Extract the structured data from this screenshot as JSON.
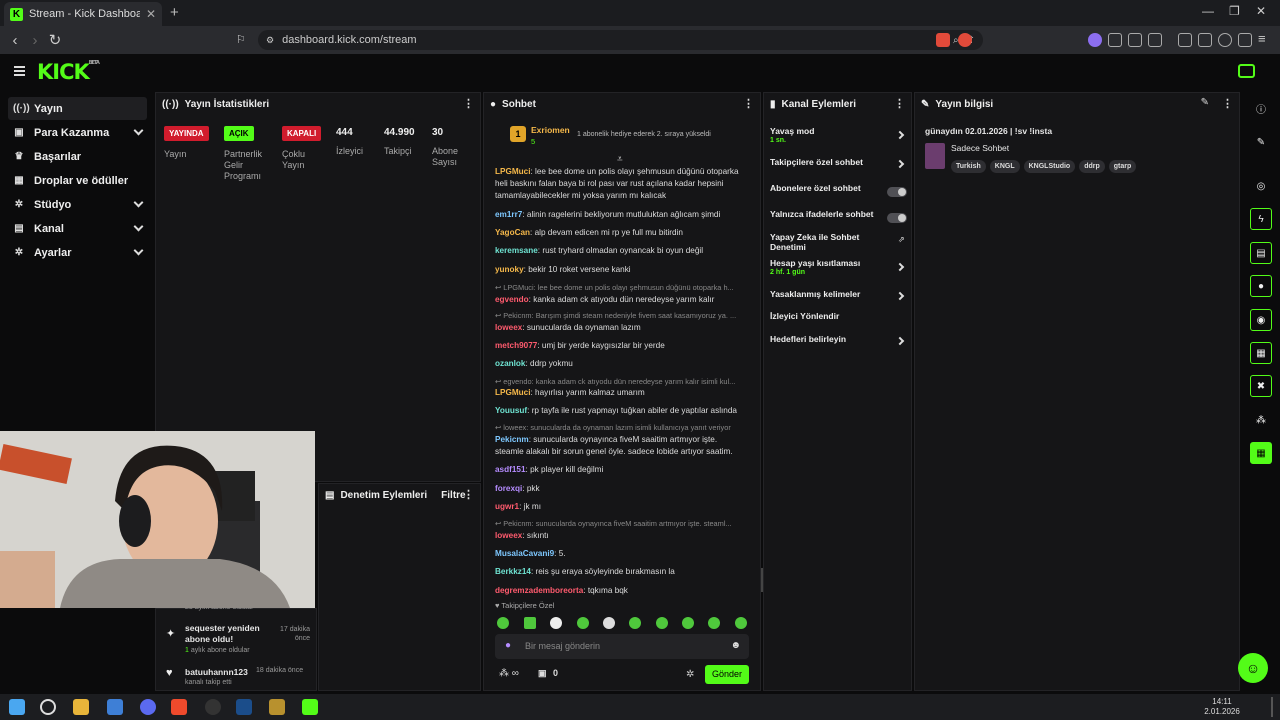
{
  "browser": {
    "tab_title": "Stream - Kick Dashboard",
    "url": "dashboard.kick.com/stream"
  },
  "brand": {
    "logo": "KICK",
    "logo_sup": "BETA",
    "accent": "#53fc18"
  },
  "sidebar": {
    "items": [
      {
        "label": "Yayın",
        "icon": "broadcast-icon"
      },
      {
        "label": "Para Kazanma",
        "icon": "money-icon"
      },
      {
        "label": "Başarılar",
        "icon": "trophy-icon"
      },
      {
        "label": "Droplar ve ödüller",
        "icon": "gift-icon"
      },
      {
        "label": "Stüdyo",
        "icon": "gear-icon"
      },
      {
        "label": "Kanal",
        "icon": "tv-icon"
      },
      {
        "label": "Ayarlar",
        "icon": "gear-icon"
      }
    ]
  },
  "stats": {
    "title": "Yayın İstatistikleri",
    "items": [
      {
        "badge": "YAYINDA",
        "label": "Yayın"
      },
      {
        "badge": "AÇIK",
        "label": "Partnerlik Gelir Programı"
      },
      {
        "badge": "KAPALI",
        "label": "Çoklu Yayın"
      },
      {
        "value": "444",
        "label": "İzleyici"
      },
      {
        "value": "44.990",
        "label": "Takipçi"
      },
      {
        "value": "30",
        "label": "Abone Sayısı"
      }
    ]
  },
  "moderation": {
    "title": "Denetim Eylemleri",
    "filter": "Filtre"
  },
  "activity": [
    {
      "name": "sequester yeniden abone oldu!",
      "time": "17 dakika önce",
      "detail_num": "1",
      "detail": "aylık abone oldular"
    },
    {
      "name": "batuuhannn123",
      "time": "18 dakika önce",
      "detail_num": "",
      "detail": "kanalı takip etti"
    }
  ],
  "activity_partial": "23 aylık abone oldular",
  "chat": {
    "title": "Sohbet",
    "pinned_user": "Exriomen",
    "pinned_count": "5",
    "pinned_text": "1 abonelik hediye ederek 2. sıraya yükseldi",
    "pinned_rank": "1",
    "lines": [
      {
        "u": "LPGMuci",
        "c": "#f5b84a",
        "t": "lee bee dome un polis olayı şehmusun düğünü otoparka"
      },
      {
        "u": "",
        "c": "",
        "t": "heli baskını falan baya bi rol pası var rust açılana kadar hepsini"
      },
      {
        "u": "",
        "c": "",
        "t": "tamamlayabilecekler mi yoksa yarım mı kalıcak"
      },
      {
        "u": "em1rr7",
        "c": "#7ec8ff",
        "t": "alinin ragelerini bekliyorum mutluluktan ağlıcam şimdi"
      },
      {
        "u": "YagoCan",
        "c": "#f5b84a",
        "t": "alp devam edicen mi rp ye full mu bitirdin"
      },
      {
        "u": "keremsane",
        "c": "#6fe3d2",
        "t": "rust tryhard olmadan oynancak bi oyun değil"
      },
      {
        "u": "yunoky",
        "c": "#f5b84a",
        "t": "bekir 10 roket versene kanki"
      },
      {
        "reply": "↩ LPGMuci: lee bee dome un polis olayı şehmusun düğünü otoparka h..."
      },
      {
        "u": "egvendo",
        "c": "#ff5b6e",
        "t": "kanka adam ck atıyodu dün neredeyse yarım kalır"
      },
      {
        "reply": "↩ Pekicnm: Barışım şimdi steam nedeniyle fivem saat kasamıyoruz ya. ..."
      },
      {
        "u": "loweex",
        "c": "#ff5b6e",
        "t": "sunucularda da oynaman lazım"
      },
      {
        "u": "metch9077",
        "c": "#ff5b6e",
        "t": "umj bir yerde kaygısızlar bir yerde"
      },
      {
        "u": "ozanlok",
        "c": "#6fe3d2",
        "t": "ddrp yokmu"
      },
      {
        "reply": "↩ egvendo: kanka adam ck atıyodu dün neredeyse yarım kalır isimli kul..."
      },
      {
        "u": "LPGMuci",
        "c": "#f5b84a",
        "t": "hayırlısı yarım kalmaz umarım"
      },
      {
        "u": "Youusuf",
        "c": "#6fe3d2",
        "t": "rp tayfa ile rust yapmayı tuğkan abiler de yaptılar aslında"
      },
      {
        "reply": "↩ loweex: sunucularda da oynaman lazım isimli kullanıcıya yanıt veriyor"
      },
      {
        "u": "Pekicnm",
        "c": "#7ec8ff",
        "t": "sunucularda oynayınca fiveM saaitim artmıyor işte."
      },
      {
        "u": "",
        "c": "",
        "t": "steamle alakalı bir sorun genel öyle. sadece lobide artıyor saatim."
      },
      {
        "u": "asdf151",
        "c": "#b58cff",
        "t": "pk player kill değilmi"
      },
      {
        "u": "forexqi",
        "c": "#b58cff",
        "t": "pkk"
      },
      {
        "u": "ugwr1",
        "c": "#ff5b6e",
        "t": "jk mı"
      },
      {
        "reply": "↩ Pekicnm: sunucularda oynayınca fiveM saaitim artmıyor işte. steaml..."
      },
      {
        "u": "loweex",
        "c": "#ff5b6e",
        "t": "sıkıntı"
      },
      {
        "u": "MusalaCavani9",
        "c": "#7ec8ff",
        "t": "5."
      },
      {
        "u": "Berkkz14",
        "c": "#6fe3d2",
        "t": "reis şu eraya söyleyinde bırakmasın la"
      },
      {
        "u": "degremzademboreorta",
        "c": "#ff5b6e",
        "t": "tqkıma bqk"
      }
    ],
    "follower_only": "Takipçilere Özel",
    "input_placeholder": "Bir mesaj gönderin",
    "send": "Gönder",
    "infinity": "∞",
    "points": "0"
  },
  "channel_actions": {
    "title": "Kanal Eylemleri",
    "items": [
      {
        "label": "Yavaş mod",
        "sub": "1 sn.",
        "ctl": "chev"
      },
      {
        "label": "Takipçilere özel sohbet",
        "sub": "",
        "ctl": "chev"
      },
      {
        "label": "Abonelere özel sohbet",
        "sub": "",
        "ctl": "toggle"
      },
      {
        "label": "Yalnızca ifadelerle sohbet",
        "sub": "",
        "ctl": "toggle"
      },
      {
        "label": "Yapay Zeka ile Sohbet Denetimi",
        "sub": "",
        "ctl": "ext"
      },
      {
        "label": "Hesap yaşı kısıtlaması",
        "sub": "2 hf. 1 gün",
        "ctl": "chev"
      },
      {
        "label": "Yasaklanmış kelimeler",
        "sub": "",
        "ctl": "chev"
      },
      {
        "label": "İzleyici Yönlendir",
        "sub": "",
        "ctl": ""
      },
      {
        "label": "Hedefleri belirleyin",
        "sub": "",
        "ctl": "chev"
      }
    ]
  },
  "stream_info": {
    "title": "Yayın bilgisi",
    "stream_title": "günaydın 02.01.2026 | !sv !insta",
    "category": "Sadece Sohbet",
    "tags": [
      "Turkish",
      "KNGL",
      "KNGLStudio",
      "ddrp",
      "gtarp"
    ]
  },
  "taskbar": {
    "time": "14:11",
    "date": "2.01.2026"
  }
}
